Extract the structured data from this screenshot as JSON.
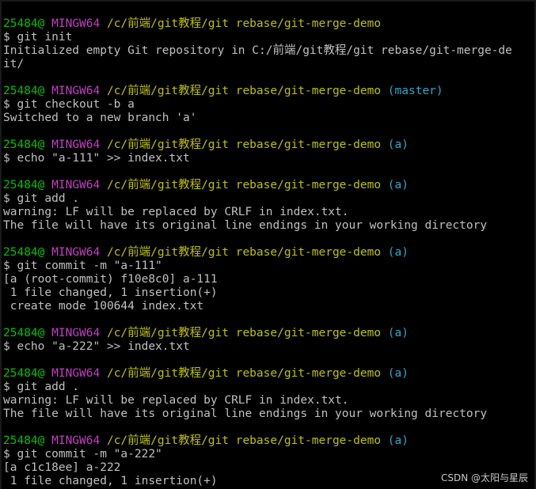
{
  "terminal": {
    "blocks": [
      {
        "prompt": {
          "user": "25484@",
          "host": "MINGW64",
          "path": "/c/前端/git教程/git rebase/git-merge-demo",
          "branch": ""
        },
        "command": "$ git init",
        "output": [
          "Initialized empty Git repository in C:/前端/git教程/git rebase/git-merge-de",
          "it/"
        ]
      },
      {
        "prompt": {
          "user": "25484@",
          "host": "MINGW64",
          "path": "/c/前端/git教程/git rebase/git-merge-demo",
          "branch": "(master)"
        },
        "command": "$ git checkout -b a",
        "output": [
          "Switched to a new branch 'a'"
        ]
      },
      {
        "prompt": {
          "user": "25484@",
          "host": "MINGW64",
          "path": "/c/前端/git教程/git rebase/git-merge-demo",
          "branch": "(a)"
        },
        "command": "$ echo \"a-111\" >> index.txt",
        "output": []
      },
      {
        "prompt": {
          "user": "25484@",
          "host": "MINGW64",
          "path": "/c/前端/git教程/git rebase/git-merge-demo",
          "branch": "(a)"
        },
        "command": "$ git add .",
        "output": [
          "warning: LF will be replaced by CRLF in index.txt.",
          "The file will have its original line endings in your working directory"
        ]
      },
      {
        "prompt": {
          "user": "25484@",
          "host": "MINGW64",
          "path": "/c/前端/git教程/git rebase/git-merge-demo",
          "branch": "(a)"
        },
        "command": "$ git commit -m \"a-111\"",
        "output": [
          "[a (root-commit) f10e8c0] a-111",
          " 1 file changed, 1 insertion(+)",
          " create mode 100644 index.txt"
        ]
      },
      {
        "prompt": {
          "user": "25484@",
          "host": "MINGW64",
          "path": "/c/前端/git教程/git rebase/git-merge-demo",
          "branch": "(a)"
        },
        "command": "$ echo \"a-222\" >> index.txt",
        "output": []
      },
      {
        "prompt": {
          "user": "25484@",
          "host": "MINGW64",
          "path": "/c/前端/git教程/git rebase/git-merge-demo",
          "branch": "(a)"
        },
        "command": "$ git add .",
        "output": [
          "warning: LF will be replaced by CRLF in index.txt.",
          "The file will have its original line endings in your working directory"
        ]
      },
      {
        "prompt": {
          "user": "25484@",
          "host": "MINGW64",
          "path": "/c/前端/git教程/git rebase/git-merge-demo",
          "branch": "(a)"
        },
        "command": "$ git commit -m \"a-222\"",
        "output": [
          "[a c1c18ee] a-222",
          " 1 file changed, 1 insertion(+)"
        ]
      }
    ]
  },
  "watermark": "CSDN @太阳与星辰",
  "colors": {
    "background": "#000000",
    "user": "#00c000",
    "host": "#c040c0",
    "path": "#c0c000",
    "branch": "#30a8c8",
    "text": "#c0c0c0"
  }
}
